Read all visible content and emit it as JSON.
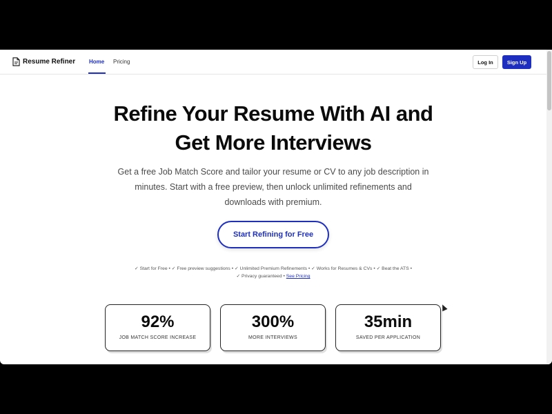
{
  "app": {
    "name": "Resume Refiner",
    "logo_icon": "document-icon"
  },
  "nav": {
    "links": [
      {
        "label": "Home",
        "active": true
      },
      {
        "label": "Pricing",
        "active": false
      }
    ],
    "login_label": "Log In",
    "signup_label": "Sign Up",
    "accent_color": "#1e2fbf"
  },
  "hero": {
    "title_line1": "Refine Your Resume With AI and",
    "title_line2": "Get More Interviews",
    "subtitle": "Get a free Job Match Score and tailor your resume or CV to any job description in minutes. Start with a free preview, then unlock unlimited refinements and downloads with premium.",
    "cta_label": "Start Refining for Free",
    "features_line1": "✓ Start for Free • ✓ Free preview suggestions • ✓ Unlimited Premium Refinements • ✓ Works for Resumes & CVs • ✓ Beat the ATS •",
    "features_line2": "✓ Privacy guaranteed •",
    "pricing_link": "See Pricing"
  },
  "stats": [
    {
      "value": "92%",
      "label": "JOB MATCH SCORE INCREASE"
    },
    {
      "value": "300%",
      "label": "MORE INTERVIEWS"
    },
    {
      "value": "35min",
      "label": "SAVED PER APPLICATION"
    }
  ]
}
